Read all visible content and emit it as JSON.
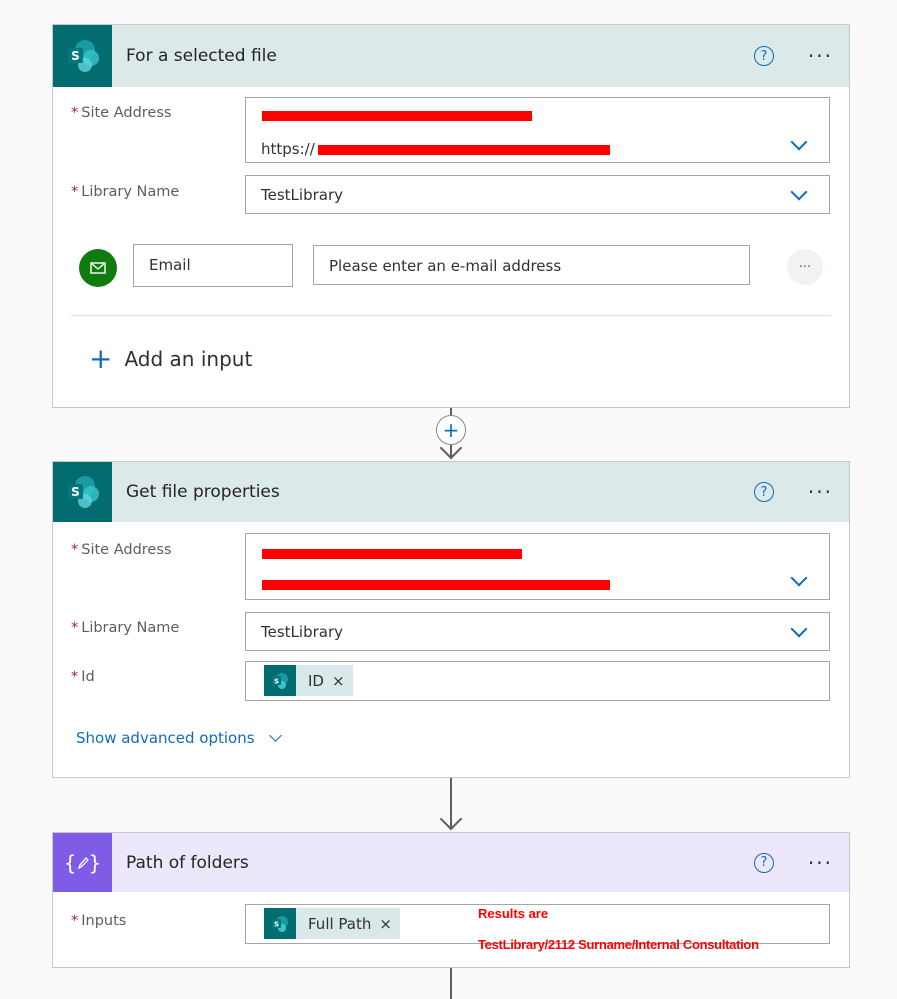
{
  "card1": {
    "title": "For a selected file",
    "icon": "sharepoint-icon",
    "site_label": "Site Address",
    "site_value_prefix": "https://",
    "library_label": "Library Name",
    "library_value": "TestLibrary",
    "email_label": "Email",
    "email_placeholder": "Please enter an e-mail address",
    "add_input": "Add an input"
  },
  "card2": {
    "title": "Get file properties",
    "icon": "sharepoint-icon",
    "site_label": "Site Address",
    "library_label": "Library Name",
    "library_value": "TestLibrary",
    "id_label": "Id",
    "id_token": "ID",
    "advanced": "Show advanced options"
  },
  "card3": {
    "title": "Path of folders",
    "icon": "compose-icon",
    "inputs_label": "Inputs",
    "token": "Full Path",
    "annotation_line1": "Results are",
    "annotation_line2": "TestLibrary/2112 Surname/Internal Consultation"
  },
  "colors": {
    "sharepoint": "#036c70",
    "sharepoint_header": "#dbe9e9",
    "compose": "#7e5ce6",
    "compose_header": "#ece7fb",
    "accent": "#0f6cbd",
    "email_icon": "#107c10",
    "annotation": "#ff0000",
    "redaction": "#ff0000"
  }
}
